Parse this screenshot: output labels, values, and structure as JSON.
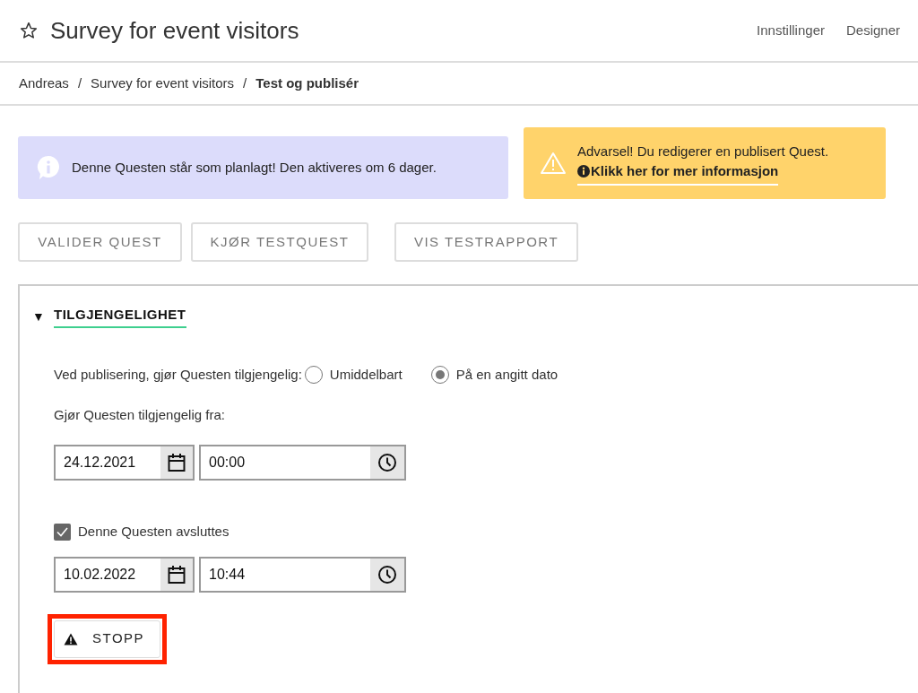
{
  "header": {
    "title": "Survey for event visitors",
    "starred": false,
    "links": [
      "Innstillinger",
      "Designer"
    ]
  },
  "breadcrumb": [
    {
      "label": "Andreas",
      "current": false
    },
    {
      "label": "Survey for event visitors",
      "current": false
    },
    {
      "label": "Test og publisér",
      "current": true
    }
  ],
  "breadcrumb_separator": "/",
  "info_alert": {
    "text": "Denne Questen står som planlagt! Den aktiveres om 6 dager."
  },
  "warning_alert": {
    "text": "Advarsel! Du redigerer en publisert Quest.",
    "link": "Klikk her for mer informasjon"
  },
  "actions": [
    "VALIDER QUEST",
    "KJØR TESTQUEST",
    "VIS TESTRAPPORT"
  ],
  "section": {
    "title": "TILGJENGELIGHET",
    "expanded": true,
    "toggle": "▼",
    "publish_label": "Ved publisering, gjør Questen tilgjengelig:",
    "options": [
      {
        "label": "Umiddelbart",
        "selected": false
      },
      {
        "label": "På en angitt dato",
        "selected": true
      }
    ],
    "from_label": "Gjør Questen tilgjengelig fra:",
    "start": {
      "date": "24.12.2021",
      "time": "00:00"
    },
    "end_checkbox": {
      "label": "Denne Questen avsluttes",
      "checked": true
    },
    "end": {
      "date": "10.02.2022",
      "time": "10:44"
    },
    "stop_button": {
      "label": "STOPP",
      "highlighted": true
    }
  }
}
